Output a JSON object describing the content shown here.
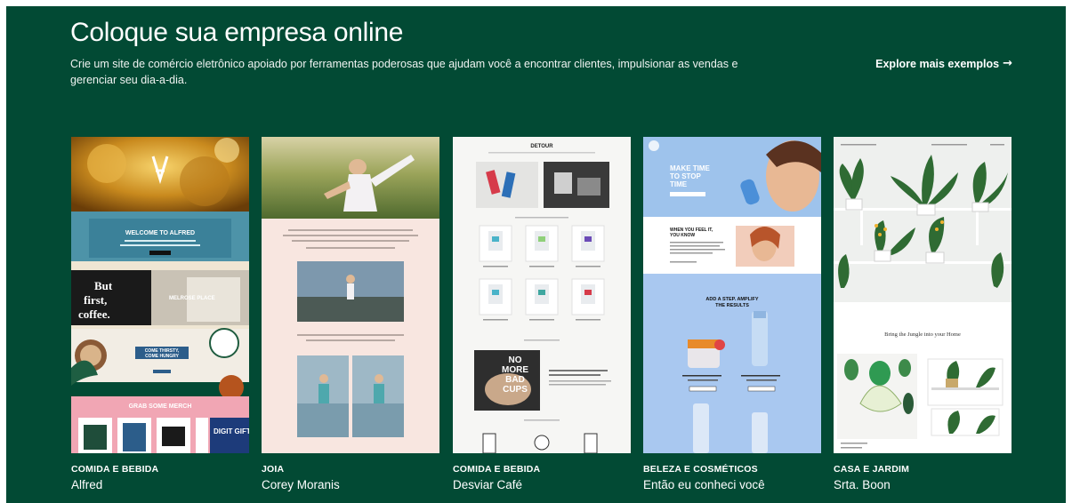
{
  "header": {
    "title": "Coloque sua empresa online",
    "subtitle": "Crie um site de comércio eletrônico apoiado por ferramentas poderosas que ajudam você a encontrar clientes, impulsionar as vendas e gerenciar seu dia-a-dia.",
    "explore_label": "Explore mais exemplos",
    "explore_arrow": "→"
  },
  "colors": {
    "background": "#024a34",
    "text": "#ffffff"
  },
  "cards": [
    {
      "category": "COMIDA E BEBIDA",
      "name": "Alfred",
      "thumb_texts": {
        "welcome": "WELCOME TO ALFRED",
        "but": "But",
        "first": "first,",
        "coffee": "coffee.",
        "melrose": "MELROSE PLACE",
        "thirsty": "COME THIRSTY,",
        "leave": "COME HUNGRY",
        "gram": "GRAB SOME MERCH",
        "gift": "DIGIT GIFTC"
      }
    },
    {
      "category": "JOIA",
      "name": "Corey Moranis",
      "thumb_texts": {}
    },
    {
      "category": "COMIDA E BEBIDA",
      "name": "Desviar Café",
      "thumb_texts": {
        "logo": "DETOUR",
        "no": "NO",
        "more": "MORE",
        "bad": "BAD",
        "cups": "CUPS"
      }
    },
    {
      "category": "BELEZA E COSMÉTICOS",
      "name": "Então eu conheci você",
      "thumb_texts": {
        "make": "MAKE TIME",
        "to": "TO STOP",
        "time": "TIME",
        "when": "WHEN YOU FEEL IT,",
        "know": "YOU KNOW",
        "add": "ADD A STEP. AMPLIFY",
        "results": "THE RESULTS"
      }
    },
    {
      "category": "CASA E JARDIM",
      "name": "Srta. Boon",
      "thumb_texts": {
        "jungle": "Bring the Jungle into your Home"
      }
    }
  ]
}
